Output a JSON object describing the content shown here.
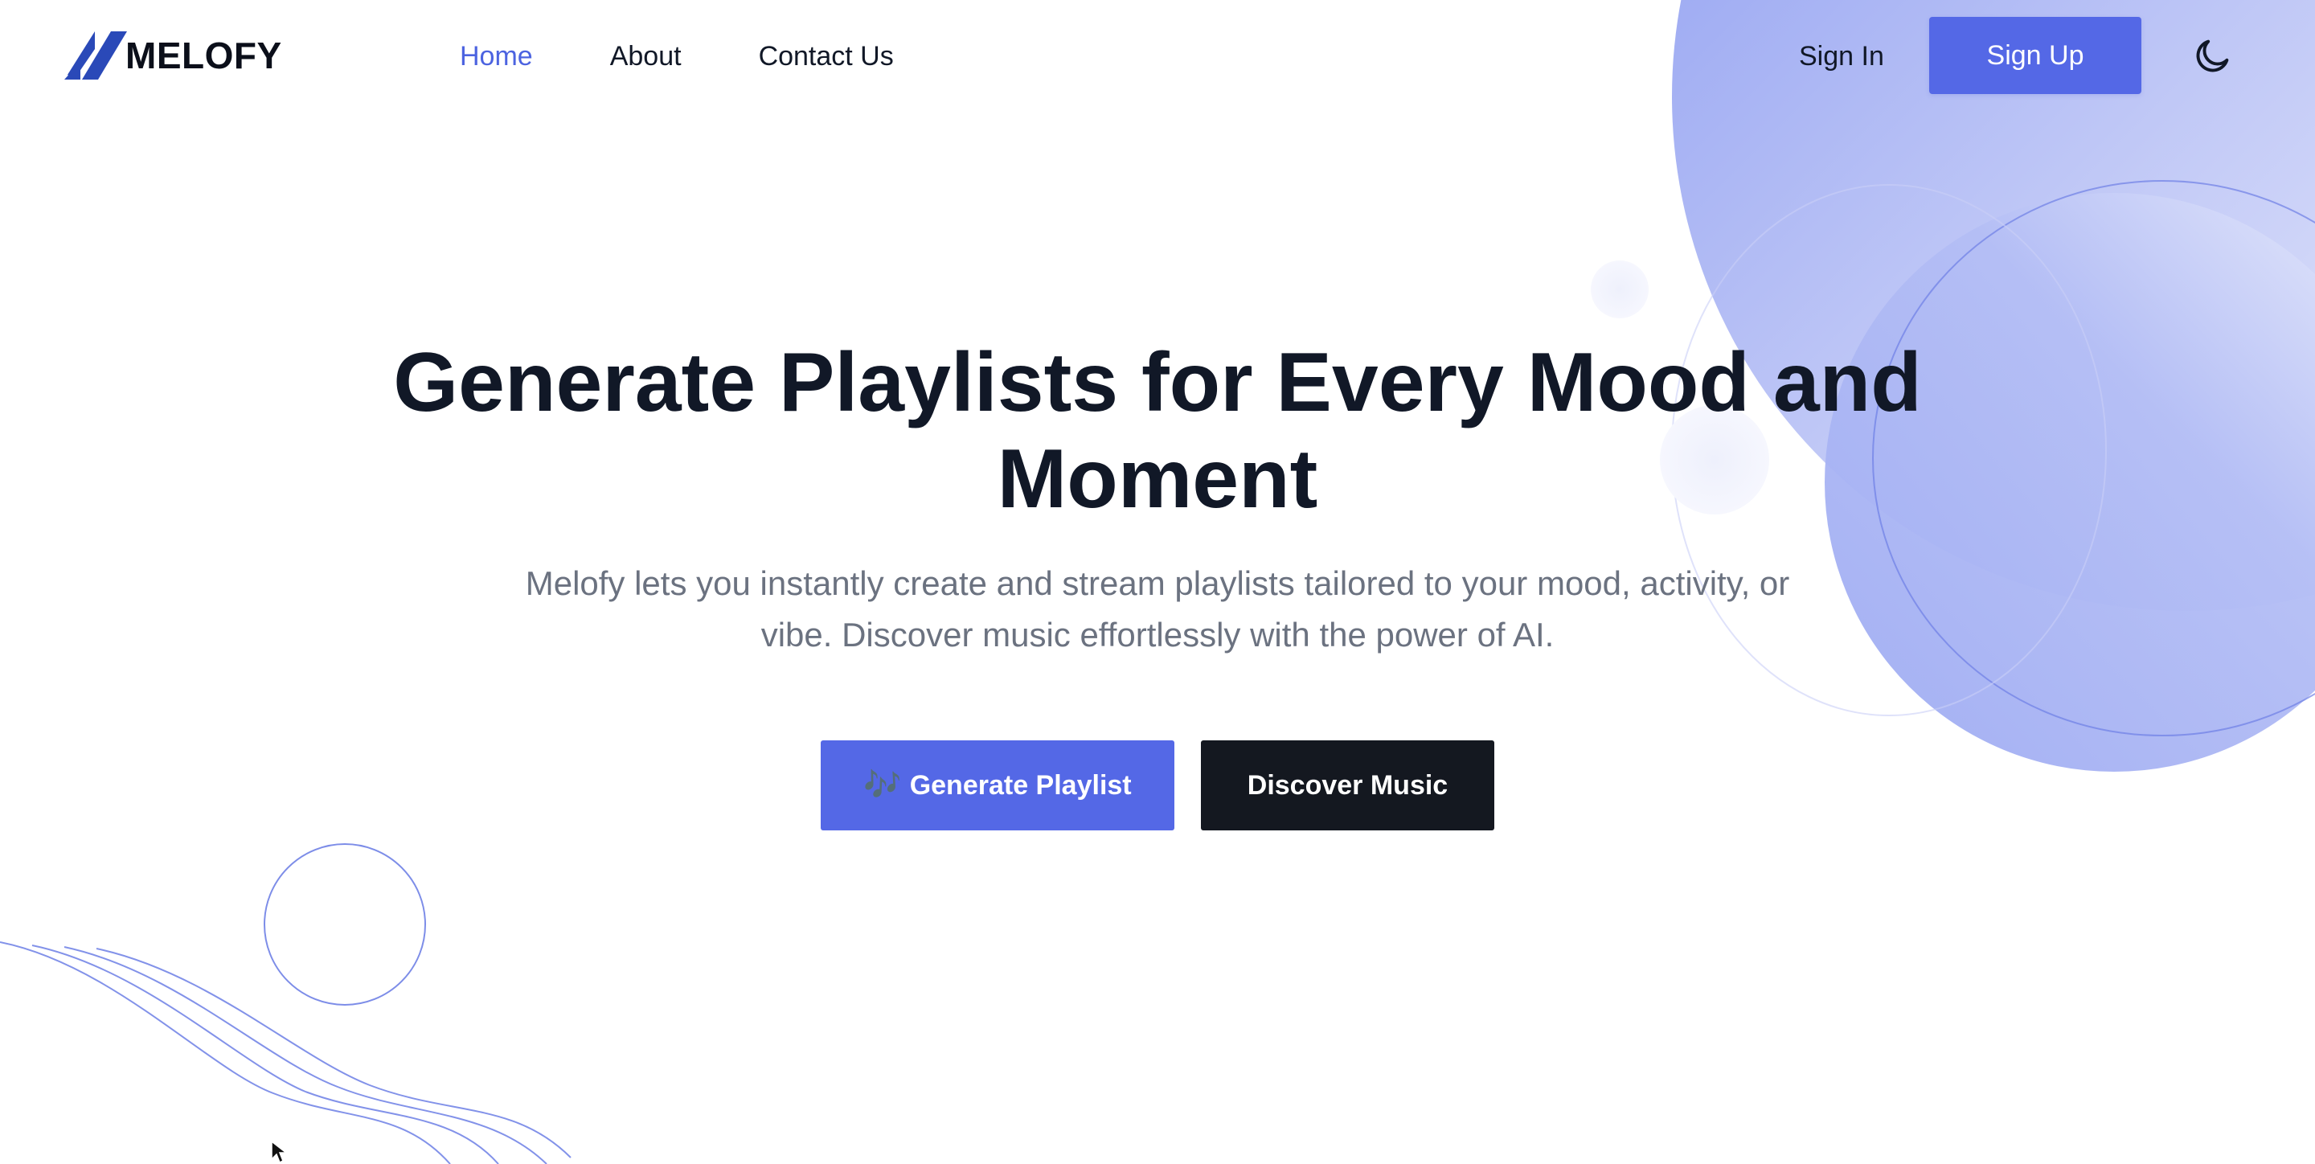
{
  "brand": {
    "name": "MELOFY",
    "accent_color": "#5468e6",
    "dark_color": "#141820"
  },
  "nav": {
    "items": [
      {
        "label": "Home",
        "active": true
      },
      {
        "label": "About",
        "active": false
      },
      {
        "label": "Contact Us",
        "active": false
      }
    ]
  },
  "auth": {
    "sign_in_label": "Sign In",
    "sign_up_label": "Sign Up"
  },
  "theme_toggle": {
    "icon": "moon-icon"
  },
  "hero": {
    "title": "Generate Playlists for Every Mood and Moment",
    "subtitle": "Melofy lets you instantly create and stream playlists tailored to your mood, activity, or vibe. Discover music effortlessly with the power of AI.",
    "primary_button": {
      "icon": "🎶",
      "label": "Generate Playlist"
    },
    "secondary_button": {
      "label": "Discover Music"
    }
  }
}
